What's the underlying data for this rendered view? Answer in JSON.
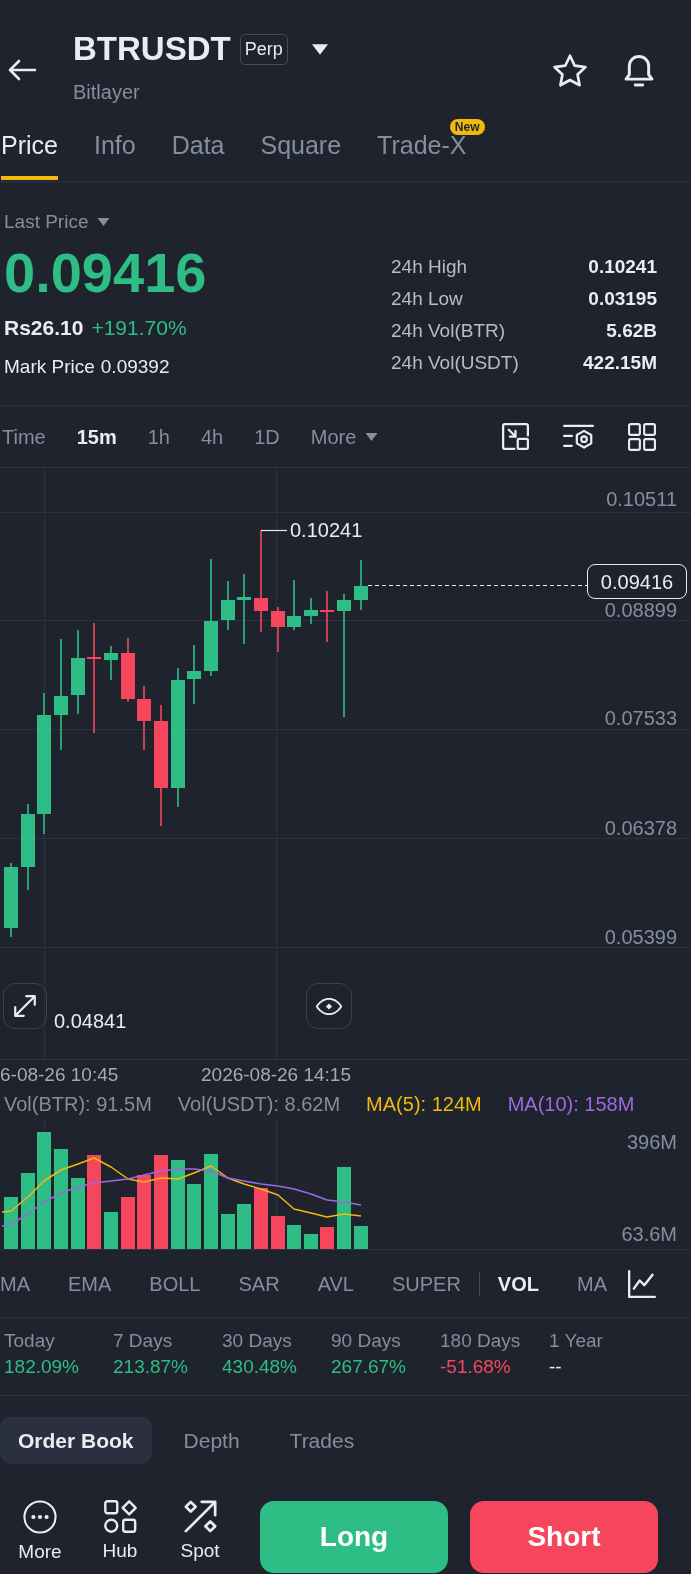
{
  "header": {
    "title": "BTRUSDT",
    "badge": "Perp",
    "subtitle": "Bitlayer"
  },
  "tabs": [
    {
      "label": "Price",
      "selected": true
    },
    {
      "label": "Info",
      "selected": false
    },
    {
      "label": "Data",
      "selected": false
    },
    {
      "label": "Square",
      "selected": false
    },
    {
      "label": "Trade-X",
      "selected": false,
      "badge": "New"
    }
  ],
  "price": {
    "type": "Last Price",
    "last": "0.09416",
    "fiat": "Rs26.10",
    "change": "+191.70%",
    "mark_label": "Mark Price",
    "mark": "0.09392"
  },
  "stats": [
    {
      "label": "24h High",
      "value": "0.10241"
    },
    {
      "label": "24h Low",
      "value": "0.03195"
    },
    {
      "label": "24h Vol(BTR)",
      "value": "5.62B"
    },
    {
      "label": "24h Vol(USDT)",
      "value": "422.15M"
    }
  ],
  "intervals": [
    {
      "label": "Time",
      "kind": "option",
      "selected": false
    },
    {
      "label": "15m",
      "kind": "option",
      "selected": true
    },
    {
      "label": "1h",
      "kind": "option",
      "selected": false
    },
    {
      "label": "4h",
      "kind": "option",
      "selected": false
    },
    {
      "label": "1D",
      "kind": "option",
      "selected": false
    },
    {
      "label": "More",
      "kind": "menu",
      "selected": false
    }
  ],
  "chart": {
    "y_labels": [
      "0.10511",
      "0.08899",
      "0.07533",
      "0.06378",
      "0.05399"
    ],
    "high": "0.10241",
    "low": "0.04841",
    "last": "0.09416",
    "x_labels": [
      "6-08-26 10:45",
      "2026-08-26 14:15"
    ]
  },
  "volume": {
    "legend": [
      {
        "text": "Vol(BTR): 91.5M",
        "color": "#848e9c"
      },
      {
        "text": "Vol(USDT): 8.62M",
        "color": "#848e9c"
      },
      {
        "text": "MA(5): 124M",
        "color": "#f0b90b"
      },
      {
        "text": "MA(10): 158M",
        "color": "#9c6ade"
      }
    ],
    "y_labels": [
      "396M",
      "63.6M"
    ]
  },
  "indicators": {
    "main": [
      {
        "label": "MA",
        "selected": false
      },
      {
        "label": "EMA",
        "selected": false
      },
      {
        "label": "BOLL",
        "selected": false
      },
      {
        "label": "SAR",
        "selected": false
      },
      {
        "label": "AVL",
        "selected": false
      },
      {
        "label": "SUPER",
        "selected": false
      }
    ],
    "sub": [
      {
        "label": "VOL",
        "selected": true
      },
      {
        "label": "MA",
        "selected": false
      }
    ]
  },
  "performance": [
    {
      "period": "Today",
      "value": "182.09%",
      "color": "#2ebd85"
    },
    {
      "period": "7 Days",
      "value": "213.87%",
      "color": "#2ebd85"
    },
    {
      "period": "30 Days",
      "value": "430.48%",
      "color": "#2ebd85"
    },
    {
      "period": "90 Days",
      "value": "267.67%",
      "color": "#2ebd85"
    },
    {
      "period": "180 Days",
      "value": "-51.68%",
      "color": "#f6465d"
    },
    {
      "period": "1 Year",
      "value": "--",
      "color": "#eaecef"
    }
  ],
  "book_tabs": [
    {
      "label": "Order Book",
      "selected": true
    },
    {
      "label": "Depth",
      "selected": false
    },
    {
      "label": "Trades",
      "selected": false
    }
  ],
  "nav": [
    {
      "label": "More"
    },
    {
      "label": "Hub"
    },
    {
      "label": "Spot"
    }
  ],
  "actions": [
    {
      "label": "Long",
      "kind": "long"
    },
    {
      "label": "Short",
      "kind": "short"
    }
  ]
}
